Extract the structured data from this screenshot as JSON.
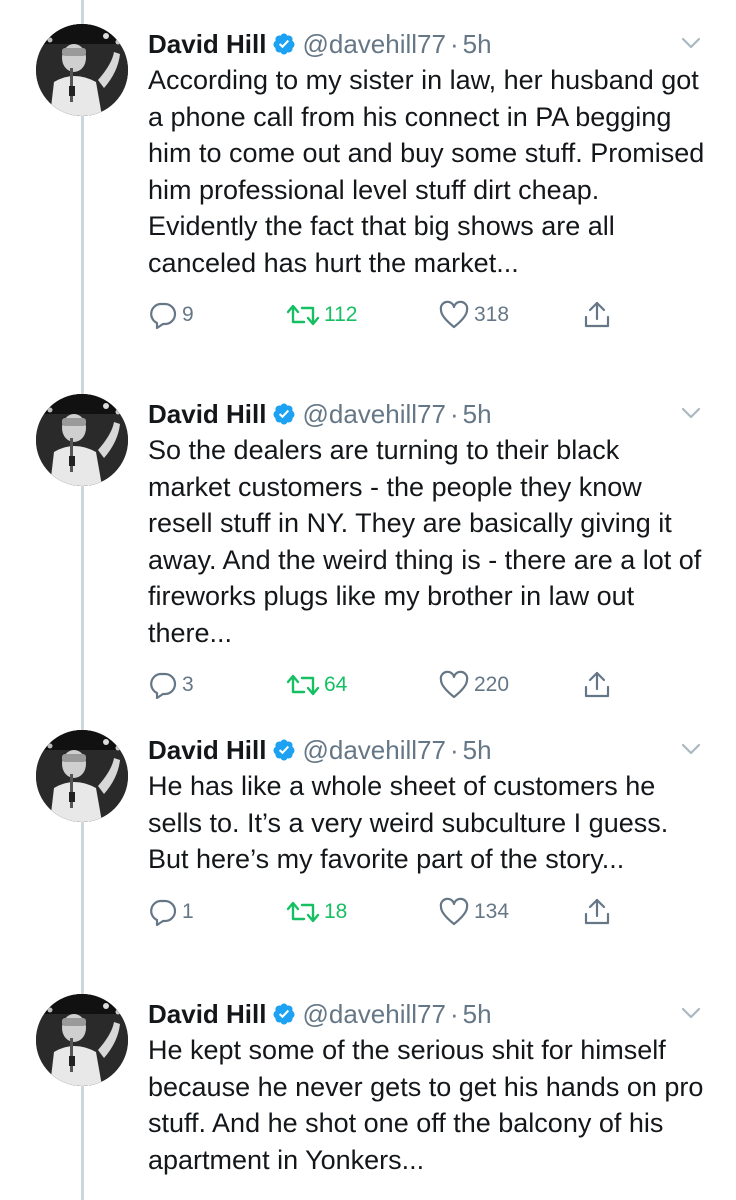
{
  "colors": {
    "text": "#14171a",
    "secondary": "#657786",
    "verified": "#1da1f2",
    "retweet": "#17bf63",
    "thread_line": "#ccd6dd"
  },
  "icons": {
    "reply": "reply-icon",
    "retweet": "retweet-icon",
    "like": "heart-icon",
    "share": "share-icon",
    "verified": "verified-badge-icon",
    "menu": "chevron-down-icon"
  },
  "tweets": [
    {
      "name": "David Hill",
      "handle": "@davehill77",
      "separator": "·",
      "time": "5h",
      "text": "According to my sister in law, her husband got a phone call from his connect in PA begging him to come out and buy some stuff. Promised him professional level stuff dirt cheap. Evidently the fact that big shows are all canceled has hurt the market...",
      "replies": "9",
      "retweets": "112",
      "likes": "318"
    },
    {
      "name": "David Hill",
      "handle": "@davehill77",
      "separator": "·",
      "time": "5h",
      "text": "So the dealers are turning to their black market customers - the people they know resell stuff in NY. They are basically giving it away. And the weird thing is - there are a lot of fireworks plugs like my brother in law out there...",
      "replies": "3",
      "retweets": "64",
      "likes": "220"
    },
    {
      "name": "David Hill",
      "handle": "@davehill77",
      "separator": "·",
      "time": "5h",
      "text": "He has like a whole sheet of customers he sells to. It’s a very weird subculture I guess. But here’s my favorite part of the story...",
      "replies": "1",
      "retweets": "18",
      "likes": "134"
    },
    {
      "name": "David Hill",
      "handle": "@davehill77",
      "separator": "·",
      "time": "5h",
      "text": "He kept some of the serious shit for himself because he never gets to get his hands on pro stuff. And he shot one off the balcony of his apartment in Yonkers..."
    }
  ]
}
